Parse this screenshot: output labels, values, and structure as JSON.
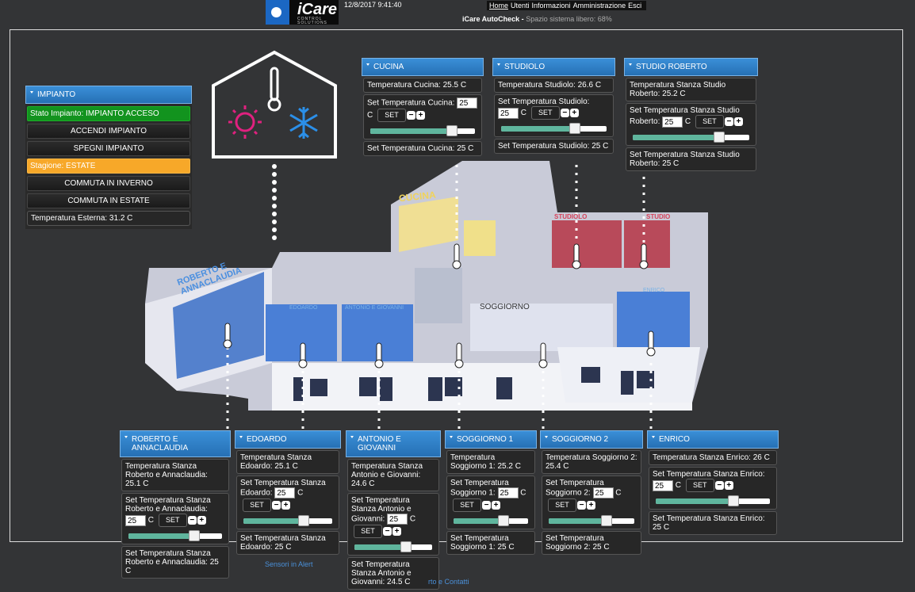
{
  "header": {
    "logo": {
      "name": "iCare",
      "sub": "CONTROL SOLUTIONS"
    },
    "datetime": "12/8/2017 9:41:40",
    "nav": [
      "Home",
      "Utenti",
      "Informazioni",
      "Amministrazione",
      "Esci"
    ],
    "autocheck_label": "iCare AutoCheck -",
    "autocheck_status": "Spazio sistema libero: 68%"
  },
  "map_labels": {
    "cucina": "CUCINA",
    "roberto": "ROBERTO E ANNACLAUDIA",
    "edoardo": "EDOARDO",
    "antonio": "ANTONIO E GIOVANNI",
    "soggiorno": "SOGGIORNO",
    "studiolo": "STUDIOLO",
    "studio": "STUDIO",
    "enrico": "ENRICO"
  },
  "impianto": {
    "title": "IMPIANTO",
    "stato": "Stato Impianto: IMPIANTO ACCESO",
    "accendi": "ACCENDI IMPIANTO",
    "spegni": "SPEGNI IMPIANTO",
    "stagione": "Stagione: ESTATE",
    "inverno": "COMMUTA IN INVERNO",
    "estate": "COMMUTA IN ESTATE",
    "temp_esterna": "Temperatura Esterna: 31.2 C"
  },
  "rooms": {
    "cucina": {
      "title": "CUCINA",
      "temp": "Temperatura Cucina: 25.5 C",
      "set_label": "Set Temperatura Cucina:",
      "value": "25",
      "unit": "C",
      "set": "SET",
      "current_set": "Set Temperatura Cucina: 25 C",
      "slider": 0.78
    },
    "studiolo": {
      "title": "STUDIOLO",
      "temp": "Temperatura Studiolo: 26.6 C",
      "set_label": "Set Temperatura Studiolo:",
      "value": "25",
      "unit": "C",
      "set": "SET",
      "current_set": "Set Temperatura Studiolo: 25 C",
      "slider": 0.7
    },
    "studio_roberto": {
      "title": "STUDIO ROBERTO",
      "temp": "Temperatura Stanza Studio Roberto: 25.2 C",
      "set_label": "Set Temperatura Stanza Studio Roberto:",
      "value": "25",
      "unit": "C",
      "set": "SET",
      "current_set": "Set Temperatura Stanza Studio Roberto: 25 C",
      "slider": 0.74
    },
    "roberto": {
      "title": "ROBERTO E ANNACLAUDIA",
      "temp": "Temperatura Stanza Roberto e Annaclaudia: 25.1 C",
      "set_label": "Set Temperatura Stanza Roberto e Annaclaudia:",
      "value": "25",
      "unit": "C",
      "set": "SET",
      "current_set": "Set Temperatura Stanza Roberto e Annaclaudia: 25 C",
      "slider": 0.7
    },
    "edoardo": {
      "title": "EDOARDO",
      "temp": "Temperatura Stanza Edoardo: 25.1 C",
      "set_label": "Set Temperatura Stanza Edoardo:",
      "value": "25",
      "unit": "C",
      "set": "SET",
      "current_set": "Set Temperatura Stanza Edoardo: 25 C",
      "slider": 0.68
    },
    "antonio": {
      "title": "ANTONIO E GIOVANNI",
      "temp": "Temperatura Stanza Antonio e Giovanni: 24.6 C",
      "set_label": "Set Temperatura Stanza Antonio e Giovanni:",
      "value": "25",
      "unit": "C",
      "set": "SET",
      "current_set": "Set Temperatura Stanza Antonio e Giovanni: 24.5 C",
      "slider": 0.66
    },
    "soggiorno1": {
      "title": "SOGGIORNO 1",
      "temp": "Temperatura Soggiorno 1: 25.2 C",
      "set_label": "Set Temperatura Soggiorno 1:",
      "value": "25",
      "unit": "C",
      "set": "SET",
      "current_set": "Set Temperatura Soggiorno 1: 25 C",
      "slider": 0.67
    },
    "soggiorno2": {
      "title": "SOGGIORNO 2",
      "temp": "Temperatura Soggiorno 2: 25.4 C",
      "set_label": "Set Temperatura Soggiorno 2:",
      "value": "25",
      "unit": "C",
      "set": "SET",
      "current_set": "Set Temperatura Soggiorno 2: 25 C",
      "slider": 0.68
    },
    "enrico": {
      "title": "ENRICO",
      "temp": "Temperatura Stanza Enrico: 26 C",
      "set_label": "Set Temperatura Stanza Enrico:",
      "value": "25",
      "unit": "C",
      "set": "SET",
      "current_set": "Set Temperatura Stanza Enrico: 25 C",
      "slider": 0.68
    }
  },
  "footer": {
    "sensori": "Sensori in Alert",
    "contatti": "rto e Contatti"
  },
  "colors": {
    "panel_head": "#2670b4",
    "green": "#12931e",
    "orange": "#f7a829",
    "slider": "#5fb59d",
    "sun": "#e0217f",
    "snow": "#2b8fe8"
  }
}
